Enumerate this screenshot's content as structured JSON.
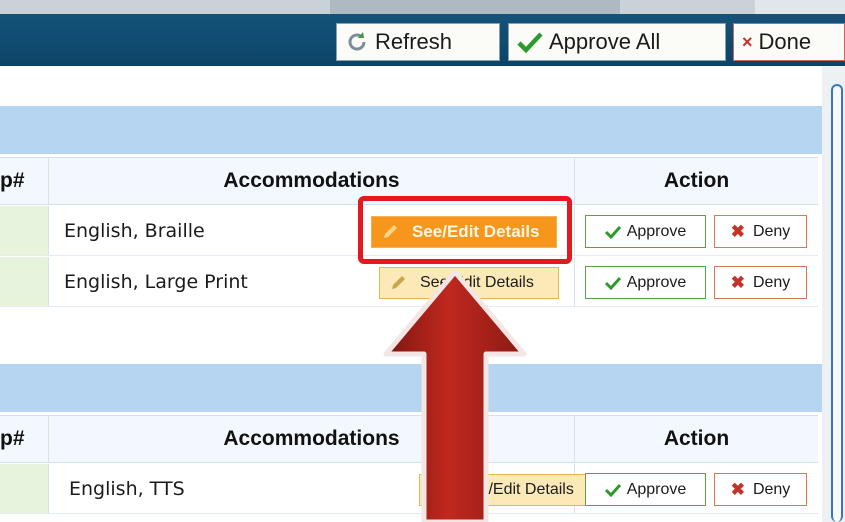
{
  "toolbar": {
    "refresh_label": "Refresh",
    "approve_all_label": "Approve All",
    "done_label": "Done"
  },
  "groups": [
    {
      "headers": {
        "col1": "p#",
        "col2": "Accommodations",
        "col3": "Action"
      },
      "rows": [
        {
          "accommodations": "English, Braille",
          "details_label": "See/Edit Details",
          "approve_label": "Approve",
          "deny_label": "Deny"
        },
        {
          "accommodations": "English, Large Print",
          "details_label": "See/Edit Details",
          "approve_label": "Approve",
          "deny_label": "Deny"
        }
      ]
    },
    {
      "headers": {
        "col1": "p#",
        "col2": "Accommodations",
        "col3": "Action"
      },
      "rows": [
        {
          "accommodations": "English, TTS",
          "details_label": "See/Edit Details",
          "approve_label": "Approve",
          "deny_label": "Deny"
        }
      ]
    }
  ],
  "icons": {
    "refresh": "refresh-icon",
    "approve": "checkmark-icon",
    "deny": "x-icon",
    "details": "pencil-icon"
  },
  "colors": {
    "toolbar": "#0b4467",
    "group_header": "#b5d5f0",
    "details_button": "#fbe9b8",
    "details_button_highlighted": "#f7961d",
    "approve_border": "#5aa14a",
    "deny_border": "#d77a4f",
    "callout_red": "#e5181f",
    "arrow": "#a8201b"
  }
}
